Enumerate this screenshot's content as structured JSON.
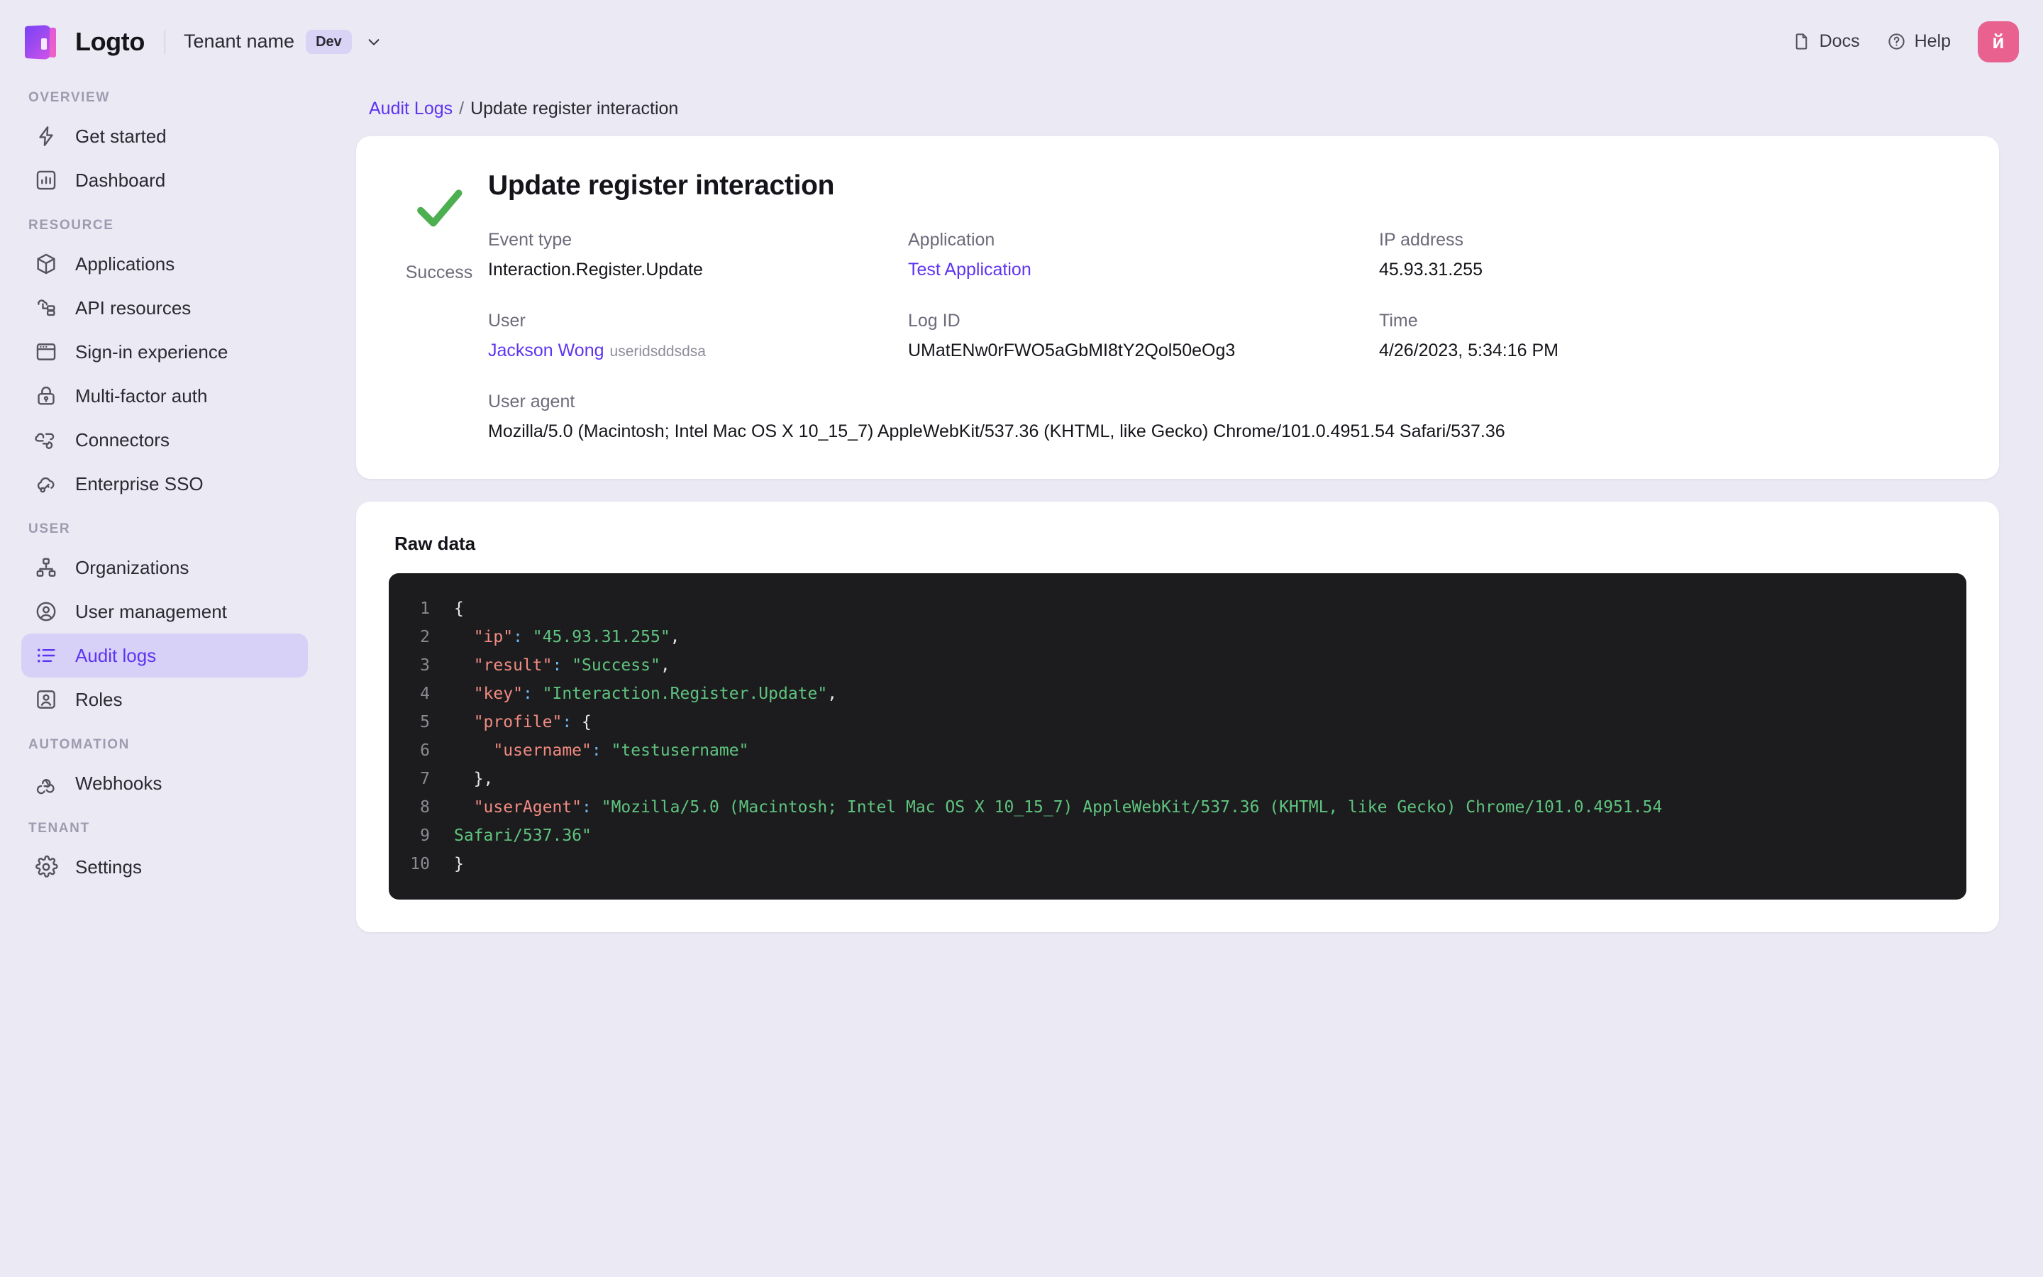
{
  "topbar": {
    "brand_name": "Logto",
    "tenant_name": "Tenant name",
    "env_badge": "Dev",
    "docs_label": "Docs",
    "help_label": "Help",
    "avatar_initial": "й",
    "icons": {
      "logo": "logto-logo-icon",
      "chevron": "chevron-down-icon",
      "docs": "document-icon",
      "help": "question-circle-icon"
    }
  },
  "sidebar": {
    "sections": [
      {
        "title": "OVERVIEW",
        "items": [
          {
            "label": "Get started",
            "icon": "bolt-icon",
            "active": false
          },
          {
            "label": "Dashboard",
            "icon": "bar-chart-icon",
            "active": false
          }
        ]
      },
      {
        "title": "RESOURCE",
        "items": [
          {
            "label": "Applications",
            "icon": "cube-icon",
            "active": false
          },
          {
            "label": "API resources",
            "icon": "api-cloud-icon",
            "active": false
          },
          {
            "label": "Sign-in experience",
            "icon": "browser-window-icon",
            "active": false
          },
          {
            "label": "Multi-factor auth",
            "icon": "lock-icon",
            "active": false
          },
          {
            "label": "Connectors",
            "icon": "connectors-cloud-icon",
            "active": false
          },
          {
            "label": "Enterprise SSO",
            "icon": "cloud-key-icon",
            "active": false
          }
        ]
      },
      {
        "title": "USER",
        "items": [
          {
            "label": "Organizations",
            "icon": "org-tree-icon",
            "active": false
          },
          {
            "label": "User management",
            "icon": "user-circle-icon",
            "active": false
          },
          {
            "label": "Audit logs",
            "icon": "list-icon",
            "active": true
          },
          {
            "label": "Roles",
            "icon": "user-badge-icon",
            "active": false
          }
        ]
      },
      {
        "title": "AUTOMATION",
        "items": [
          {
            "label": "Webhooks",
            "icon": "webhook-icon",
            "active": false
          }
        ]
      },
      {
        "title": "TENANT",
        "items": [
          {
            "label": "Settings",
            "icon": "gear-icon",
            "active": false
          }
        ]
      }
    ]
  },
  "breadcrumb": {
    "parent": "Audit Logs",
    "separator": "/",
    "current": "Update register interaction"
  },
  "detail": {
    "status_icon": "green-check-icon",
    "status_text": "Success",
    "title": "Update register interaction",
    "fields": [
      {
        "label": "Event type",
        "value": "Interaction.Register.Update",
        "link": false
      },
      {
        "label": "Application",
        "value": "Test Application",
        "link": true
      },
      {
        "label": "IP address",
        "value": "45.93.31.255",
        "link": false
      },
      {
        "label": "User",
        "value": "Jackson Wong",
        "sub": "useridsddsdsa",
        "link": true
      },
      {
        "label": "Log ID",
        "value": "UMatENw0rFWO5aGbMI8tY2Qol50eOg3",
        "link": false
      },
      {
        "label": "Time",
        "value": "4/26/2023, 5:34:16 PM",
        "link": false
      }
    ],
    "user_agent_label": "User agent",
    "user_agent_value": "Mozilla/5.0 (Macintosh; Intel Mac OS X 10_15_7) AppleWebKit/537.36 (KHTML, like Gecko) Chrome/101.0.4951.54 Safari/537.36"
  },
  "raw": {
    "title": "Raw data",
    "lines": [
      {
        "n": "1",
        "tokens": [
          {
            "t": "b",
            "v": "{"
          }
        ]
      },
      {
        "n": "2",
        "tokens": [
          {
            "t": "p",
            "v": "  \"ip\""
          },
          {
            "t": "c",
            "v": ":"
          },
          {
            "t": "s",
            "v": " \"45.93.31.255\""
          },
          {
            "t": "b",
            "v": ","
          }
        ]
      },
      {
        "n": "3",
        "tokens": [
          {
            "t": "p",
            "v": "  \"result\""
          },
          {
            "t": "c",
            "v": ":"
          },
          {
            "t": "s",
            "v": " \"Success\""
          },
          {
            "t": "b",
            "v": ","
          }
        ]
      },
      {
        "n": "4",
        "tokens": [
          {
            "t": "p",
            "v": "  \"key\""
          },
          {
            "t": "c",
            "v": ":"
          },
          {
            "t": "s",
            "v": " \"Interaction.Register.Update\""
          },
          {
            "t": "b",
            "v": ","
          }
        ]
      },
      {
        "n": "5",
        "tokens": [
          {
            "t": "p",
            "v": "  \"profile\""
          },
          {
            "t": "c",
            "v": ":"
          },
          {
            "t": "b",
            "v": " {"
          }
        ]
      },
      {
        "n": "6",
        "tokens": [
          {
            "t": "p",
            "v": "    \"username\""
          },
          {
            "t": "c",
            "v": ":"
          },
          {
            "t": "s",
            "v": " \"testusername\""
          }
        ]
      },
      {
        "n": "7",
        "tokens": [
          {
            "t": "b",
            "v": "  },"
          }
        ]
      },
      {
        "n": "8",
        "tokens": [
          {
            "t": "p",
            "v": "  \"userAgent\""
          },
          {
            "t": "c",
            "v": ":"
          },
          {
            "t": "s",
            "v": " \"Mozilla/5.0 (Macintosh; Intel Mac OS X 10_15_7) AppleWebKit/537.36 (KHTML, like Gecko) Chrome/101.0.4951.54"
          }
        ]
      },
      {
        "n": "9",
        "tokens": [
          {
            "t": "s",
            "v": "Safari/537.36\""
          }
        ]
      },
      {
        "n": "10",
        "tokens": [
          {
            "t": "b",
            "v": "}"
          }
        ]
      }
    ]
  },
  "colors": {
    "page_bg": "#eae9f4",
    "card_bg": "#ffffff",
    "accent": "#5d34f2",
    "active_nav_bg": "#d7d1f7",
    "success_green": "#4caf50",
    "code_bg": "#1c1c1e",
    "code_key": "#f28b82",
    "code_string": "#5fc47f",
    "code_colon": "#6fb8f0",
    "avatar_bg": "#e8618f"
  }
}
